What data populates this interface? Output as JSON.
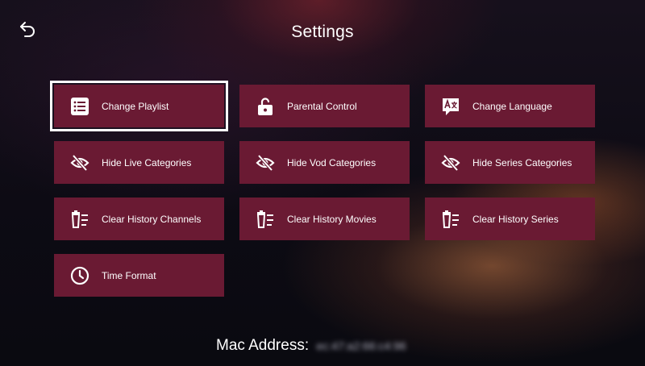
{
  "header": {
    "title": "Settings"
  },
  "tiles": [
    {
      "label": "Change Playlist",
      "icon": "list-icon",
      "selected": true
    },
    {
      "label": "Parental Control",
      "icon": "lock-icon"
    },
    {
      "label": "Change Language",
      "icon": "translate-icon"
    },
    {
      "label": "Hide Live Categories",
      "icon": "eye-off-icon"
    },
    {
      "label": "Hide Vod Categories",
      "icon": "eye-off-icon"
    },
    {
      "label": "Hide Series Categories",
      "icon": "eye-off-icon"
    },
    {
      "label": "Clear History Channels",
      "icon": "clear-list-icon"
    },
    {
      "label": "Clear History Movies",
      "icon": "clear-list-icon"
    },
    {
      "label": "Clear History Series",
      "icon": "clear-list-icon"
    },
    {
      "label": "Time Format",
      "icon": "clock-icon"
    }
  ],
  "footer": {
    "mac_label": "Mac Address:",
    "mac_value": "ec:47:a2:66:c4:96"
  },
  "colors": {
    "tile": "#6a1a33",
    "selected_border": "#ffffff",
    "text": "#ffffff"
  }
}
